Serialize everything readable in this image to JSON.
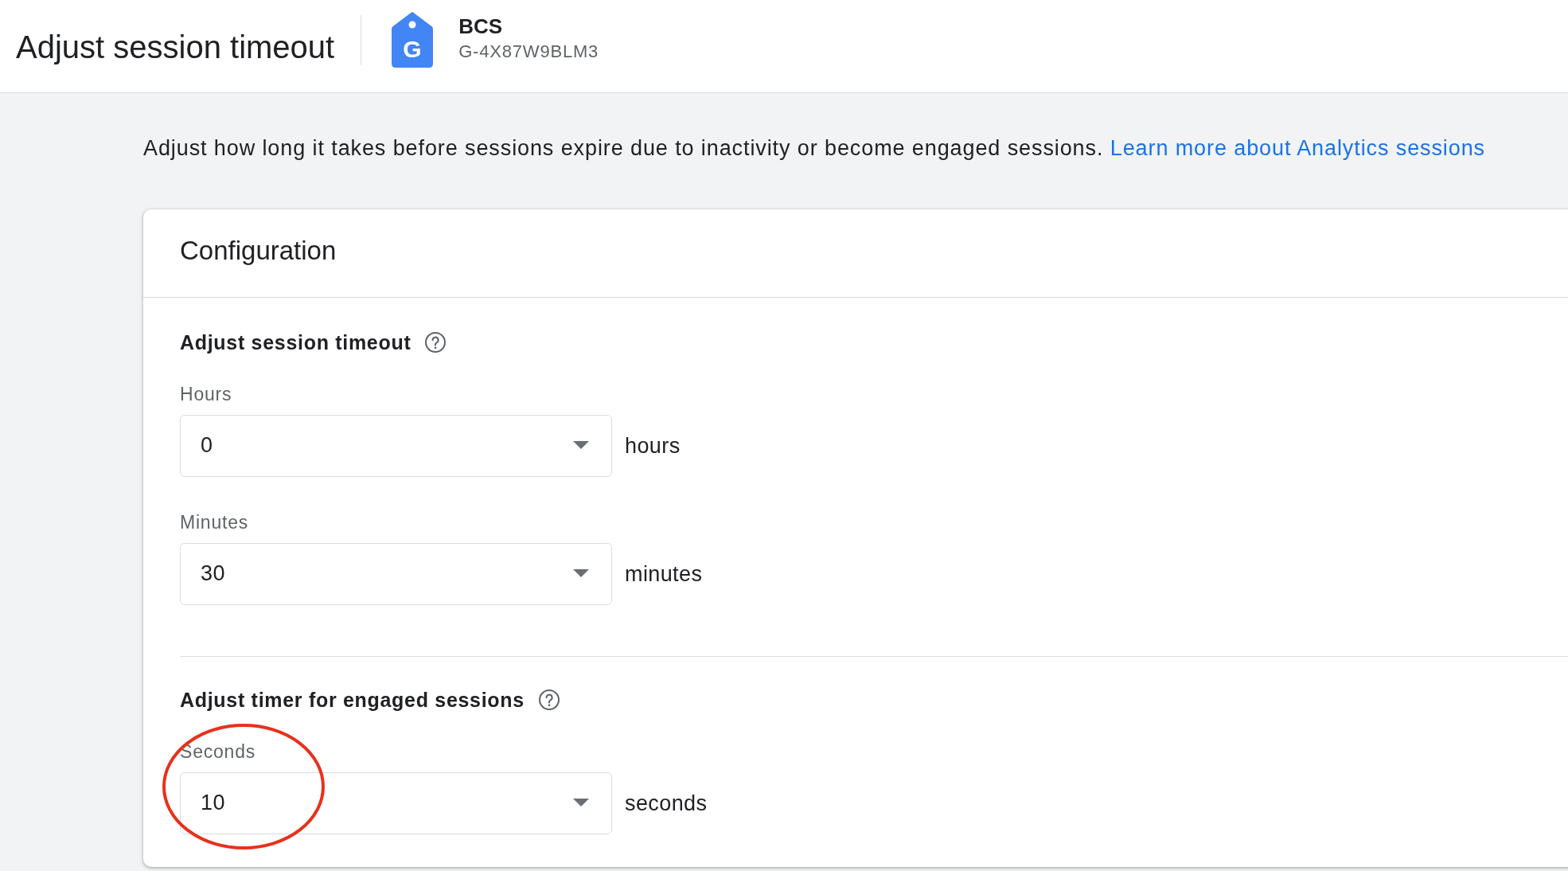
{
  "header": {
    "title": "Adjust session timeout",
    "property": {
      "icon_letter": "G",
      "name": "BCS",
      "id": "G-4X87W9BLM3"
    }
  },
  "description": {
    "text": "Adjust how long it takes before sessions expire due to inactivity or become engaged sessions.",
    "link": "Learn more about Analytics sessions"
  },
  "card": {
    "title": "Configuration",
    "sections": [
      {
        "heading": "Adjust session timeout",
        "fields": [
          {
            "label": "Hours",
            "value": "0",
            "unit": "hours",
            "highlighted": false
          },
          {
            "label": "Minutes",
            "value": "30",
            "unit": "minutes",
            "highlighted": false
          }
        ]
      },
      {
        "heading": "Adjust timer for engaged sessions",
        "fields": [
          {
            "label": "Seconds",
            "value": "10",
            "unit": "seconds",
            "highlighted": true
          }
        ]
      }
    ]
  }
}
